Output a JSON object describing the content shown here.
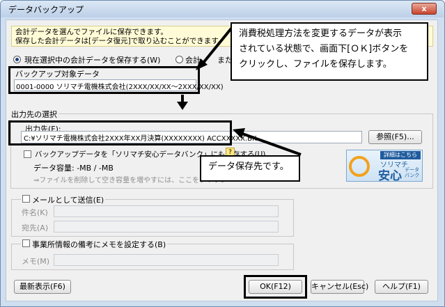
{
  "window": {
    "title": "データバックアップ",
    "close_label": "x"
  },
  "info": {
    "line1": "会計データを選んでファイルに保存できます。",
    "line2": "保存した会計データは[データ復元]で取り込むことができます。"
  },
  "source": {
    "radio_current": "現在選択中の会計データを保存する(W)",
    "radio_other": "会計",
    "radio_other_tail": "また",
    "label": "バックアップ対象データ",
    "value": "0001-0000 ソリマチ電機株式会社(2XXX/XX/XX～2XXX/XX/XX)"
  },
  "output": {
    "group_title": "出力先の選択",
    "path_label": "出力先(F):",
    "path_value": "C:¥ソリマチ電機株式会社2XXX年XX月決算(XXXXXXXX) ACCXXXXX.BK",
    "browse_button": "参照(F5)...",
    "bank_checkbox": "バックアップデータを「ソリマチ安心データバンク」にも保存する(U)",
    "help_badge": "?",
    "capacity": "データ容量:  -MB / -MB",
    "capacity_hint": "⇒ファイルを削除して空き容量を増やすには、ここをクリック"
  },
  "banner": {
    "top": "詳細はこちら",
    "brand": "ソリマチ",
    "big": "安心",
    "sub": "データ バンク"
  },
  "mail": {
    "checkbox": "メールとして送信(E)",
    "subject_label": "件名(K)",
    "to_label": "宛先(A)"
  },
  "memo": {
    "checkbox": "事業所情報の備考にメモを設定する(B)",
    "memo_label": "メモ(M)"
  },
  "buttons": {
    "refresh": "最新表示(F6)",
    "ok": "OK(F12)",
    "cancel": "キャンセル(Esc)",
    "help": "ヘルプ(F1)"
  },
  "callouts": {
    "top_line1": "消費税処理方法を変更するデータが表示",
    "top_line2": "されている状態で、画面下[ＯＫ]ボタンを",
    "top_line3": "クリックし、ファイルを保存します。",
    "mid": "データ保存先です。"
  }
}
